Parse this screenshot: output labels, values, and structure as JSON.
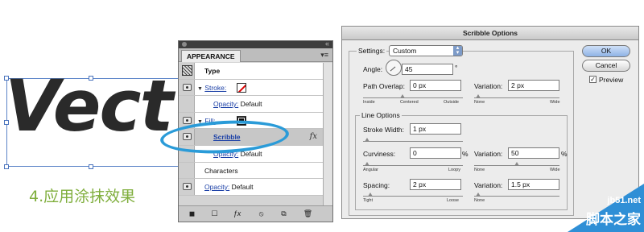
{
  "artwork": {
    "text": "Vect",
    "caption": "4.应用涂抹效果"
  },
  "panel": {
    "tab": "APPEARANCE",
    "close": "×",
    "collapse": "«",
    "menu": "▾≡",
    "rows": {
      "type": "Type",
      "stroke_label": "Stroke:",
      "opacity_label": "Opacity:",
      "opacity_value": "Default",
      "fill_label": "Fill:",
      "scribble": "Scribble",
      "fx": "fx",
      "characters": "Characters"
    },
    "bottom_icons": [
      "new-art-icon",
      "clear-appearance-icon",
      "fx-menu-icon",
      "clear-icon",
      "duplicate-icon",
      "delete-icon"
    ]
  },
  "dialog": {
    "title": "Scribble Options",
    "settings_label": "Settings:",
    "settings_value": "Custom",
    "angle_label": "Angle:",
    "angle_value": "45",
    "angle_unit": "°",
    "path_overlap_label": "Path Overlap:",
    "path_overlap_value": "0 px",
    "variation_label": "Variation:",
    "path_overlap_variation": "2 px",
    "inside": "Inside",
    "centered": "Centered",
    "outside": "Outside",
    "none": "None",
    "wide": "Wide",
    "line_options": "Line Options",
    "stroke_width_label": "Stroke Width:",
    "stroke_width_value": "1 px",
    "curviness_label": "Curviness:",
    "curviness_value": "0",
    "curviness_variation": "50",
    "percent": "%",
    "angular": "Angular",
    "loopy": "Loopy",
    "spacing_label": "Spacing:",
    "spacing_value": "2 px",
    "spacing_variation": "1.5 px",
    "tight": "Tight",
    "loose": "Loose",
    "ok": "OK",
    "cancel": "Cancel",
    "preview": "Preview",
    "preview_checked": "✓"
  },
  "watermark": {
    "site": "jb51.net",
    "name": "脚本之家"
  },
  "colors": {
    "caption": "#7fae3c",
    "highlight": "#2a9bd8",
    "watermark": "#2f8fd6"
  }
}
